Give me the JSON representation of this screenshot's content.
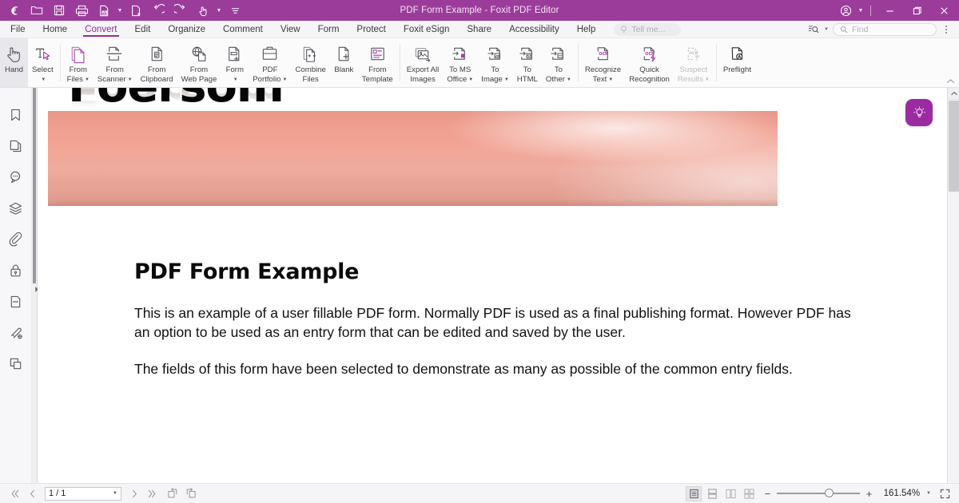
{
  "titlebar": {
    "title": "PDF Form Example - Foxit PDF Editor",
    "quick_access": [
      {
        "name": "foxit-logo-icon",
        "label": "Foxit"
      },
      {
        "name": "open-folder-icon",
        "label": "Open"
      },
      {
        "name": "save-icon",
        "label": "Save"
      },
      {
        "name": "print-icon",
        "label": "Print"
      },
      {
        "name": "email-document-icon",
        "label": "Email"
      },
      {
        "name": "create-pdf-icon",
        "label": "Create PDF"
      },
      {
        "name": "undo-icon",
        "label": "Undo"
      },
      {
        "name": "redo-icon",
        "label": "Redo"
      },
      {
        "name": "touch-mode-icon",
        "label": "Touch Mode"
      },
      {
        "name": "customize-toolbar-icon",
        "label": "Customize"
      }
    ],
    "account_label": "Account",
    "minimize_label": "Minimize",
    "restore_label": "Restore",
    "close_label": "Close",
    "bar_color": "#9B3C9B"
  },
  "menubar": {
    "items": [
      {
        "label": "File",
        "active": false
      },
      {
        "label": "Home",
        "active": false
      },
      {
        "label": "Convert",
        "active": true
      },
      {
        "label": "Edit",
        "active": false
      },
      {
        "label": "Organize",
        "active": false
      },
      {
        "label": "Comment",
        "active": false
      },
      {
        "label": "View",
        "active": false
      },
      {
        "label": "Form",
        "active": false
      },
      {
        "label": "Protect",
        "active": false
      },
      {
        "label": "Foxit eSign",
        "active": false
      },
      {
        "label": "Share",
        "active": false
      },
      {
        "label": "Accessibility",
        "active": false
      },
      {
        "label": "Help",
        "active": false
      }
    ],
    "tell_me_placeholder": "Tell me...",
    "find_placeholder": "Find",
    "search_options_label": "Search options",
    "more_label": "More",
    "active_color": "#8E2F8E"
  },
  "ribbon": {
    "collapse_label": "Collapse ribbon",
    "groups": [
      {
        "items": [
          {
            "name": "hand-tool",
            "icon": "hand",
            "line1": "Hand",
            "line2": "",
            "caret": false,
            "state": "selected"
          },
          {
            "name": "select-tool",
            "icon": "select",
            "line1": "Select",
            "line2": "",
            "caret": true,
            "caret_on": "line2",
            "state": "normal"
          }
        ]
      },
      {
        "items": [
          {
            "name": "from-files",
            "icon": "from-files",
            "line1": "From",
            "line2": "Files",
            "caret": true,
            "state": "normal"
          },
          {
            "name": "from-scanner",
            "icon": "from-scanner",
            "line1": "From",
            "line2": "Scanner",
            "caret": true,
            "state": "normal"
          },
          {
            "name": "from-clipboard",
            "icon": "from-clipboard",
            "line1": "From",
            "line2": "Clipboard",
            "caret": false,
            "state": "normal"
          },
          {
            "name": "from-web-page",
            "icon": "from-web-page",
            "line1": "From",
            "line2": "Web Page",
            "caret": false,
            "state": "normal"
          },
          {
            "name": "form",
            "icon": "form",
            "line1": "Form",
            "line2": "",
            "caret": true,
            "caret_on": "line2",
            "state": "normal"
          },
          {
            "name": "pdf-portfolio",
            "icon": "pdf-portfolio",
            "line1": "PDF",
            "line2": "Portfolio",
            "caret": true,
            "state": "normal"
          },
          {
            "name": "combine-files",
            "icon": "combine-files",
            "line1": "Combine",
            "line2": "Files",
            "caret": false,
            "state": "normal"
          },
          {
            "name": "blank",
            "icon": "blank",
            "line1": "Blank",
            "line2": "",
            "caret": false,
            "state": "normal"
          },
          {
            "name": "from-template",
            "icon": "from-template",
            "line1": "From",
            "line2": "Template",
            "caret": false,
            "state": "normal"
          }
        ]
      },
      {
        "items": [
          {
            "name": "export-all-images",
            "icon": "export-images",
            "line1": "Export All",
            "line2": "Images",
            "caret": false,
            "state": "normal"
          },
          {
            "name": "to-ms-office",
            "icon": "to-office",
            "line1": "To MS",
            "line2": "Office",
            "caret": true,
            "state": "normal"
          },
          {
            "name": "to-image",
            "icon": "to-image",
            "line1": "To",
            "line2": "Image",
            "caret": true,
            "state": "normal"
          },
          {
            "name": "to-html",
            "icon": "to-html",
            "line1": "To",
            "line2": "HTML",
            "caret": false,
            "state": "normal"
          },
          {
            "name": "to-other",
            "icon": "to-other",
            "line1": "To",
            "line2": "Other",
            "caret": true,
            "state": "normal"
          }
        ]
      },
      {
        "items": [
          {
            "name": "recognize-text",
            "icon": "ocr-text",
            "line1": "Recognize",
            "line2": "Text",
            "caret": true,
            "state": "normal"
          },
          {
            "name": "quick-recognition",
            "icon": "ocr-quick",
            "line1": "Quick",
            "line2": "Recognition",
            "caret": false,
            "state": "normal"
          },
          {
            "name": "suspect-results",
            "icon": "ocr-suspect",
            "line1": "Suspect",
            "line2": "Results",
            "caret": true,
            "state": "disabled"
          }
        ]
      },
      {
        "items": [
          {
            "name": "preflight",
            "icon": "preflight",
            "line1": "Preflight",
            "line2": "",
            "caret": false,
            "state": "normal"
          }
        ]
      }
    ]
  },
  "navpane": {
    "items": [
      {
        "name": "bookmarks-panel",
        "label": "Bookmarks",
        "icon": "bookmark"
      },
      {
        "name": "page-thumbnails-panel",
        "label": "Page Thumbnails",
        "icon": "pages"
      },
      {
        "name": "comments-panel",
        "label": "Comments",
        "icon": "comment"
      },
      {
        "name": "layers-panel",
        "label": "Layers",
        "icon": "layers"
      },
      {
        "name": "attachments-panel",
        "label": "Attachments",
        "icon": "attachment"
      },
      {
        "name": "security-panel",
        "label": "Security",
        "icon": "lock"
      },
      {
        "name": "fields-panel",
        "label": "Fields",
        "icon": "field"
      },
      {
        "name": "signatures-panel",
        "label": "Digital Signatures",
        "icon": "signature"
      },
      {
        "name": "stamps-panel",
        "label": "Stamps",
        "icon": "stamp"
      }
    ],
    "expand_label": "Expand panel"
  },
  "document": {
    "banner_text": "Foersom",
    "heading": "PDF Form Example",
    "paragraph1": "This is an example of a user fillable PDF form. Normally PDF is used as a final publishing format. However PDF has an option to be used as an entry form that can be edited and saved by the user.",
    "paragraph2": "The fields of this form have been selected to demonstrate as many as possible of the common entry fields.",
    "banner_color": "#ef9e8e"
  },
  "assistant": {
    "name": "ai-assistant-button",
    "label": "AI Assistant",
    "color": "#9B2BA0"
  },
  "statusbar": {
    "first_page_label": "First Page",
    "prev_page_label": "Previous Page",
    "page_value": "1 / 1",
    "next_page_label": "Next Page",
    "last_page_label": "Last Page",
    "rotate_left_label": "Rotate Left",
    "rotate_right_label": "Rotate Right",
    "view_single_label": "Single Page View",
    "view_continuous_label": "Continuous Scrolling",
    "view_facing_label": "Facing View",
    "view_facing_cont_label": "Facing Continuous",
    "zoom_out_label": "Zoom Out",
    "zoom_in_label": "Zoom In",
    "zoom_value": "161.54%",
    "fullscreen_label": "Full Screen"
  }
}
